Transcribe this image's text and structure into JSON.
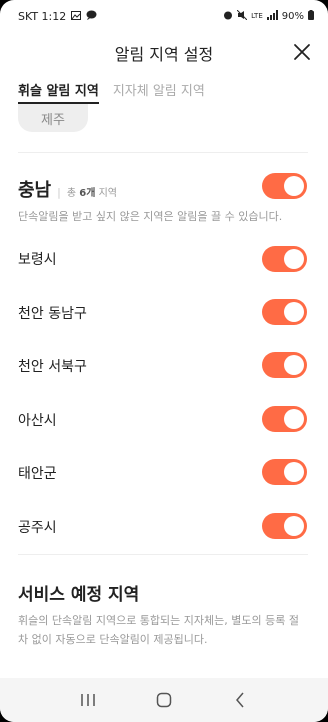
{
  "status_bar": {
    "carrier_time": "SKT 1:12",
    "lte": "LTE",
    "battery": "90%"
  },
  "header": {
    "title": "알림 지역 설정"
  },
  "tabs": [
    {
      "label": "휘슬 알림 지역",
      "active": true
    },
    {
      "label": "지자체 알림 지역",
      "active": false
    }
  ],
  "chip": {
    "label": "제주"
  },
  "region": {
    "name": "충남",
    "count_prefix": "총",
    "count": "6개",
    "count_suffix": "지역",
    "description": "단속알림을 받고 싶지 않은 지역은 알림을 끌 수 있습니다.",
    "master_on": true
  },
  "cities": [
    {
      "name": "보령시",
      "on": true
    },
    {
      "name": "천안 동남구",
      "on": true
    },
    {
      "name": "천안 서북구",
      "on": true
    },
    {
      "name": "아산시",
      "on": true
    },
    {
      "name": "태안군",
      "on": true
    },
    {
      "name": "공주시",
      "on": true
    }
  ],
  "service": {
    "title": "서비스 예정 지역",
    "description": "휘슬의 단속알림 지역으로 통합되는 지자체는, 별도의 등록 절차 없이 자동으로 단속알림이 제공됩니다."
  },
  "colors": {
    "toggle_on": "#ff6b45",
    "text_primary": "#222222",
    "text_secondary": "#999999"
  }
}
